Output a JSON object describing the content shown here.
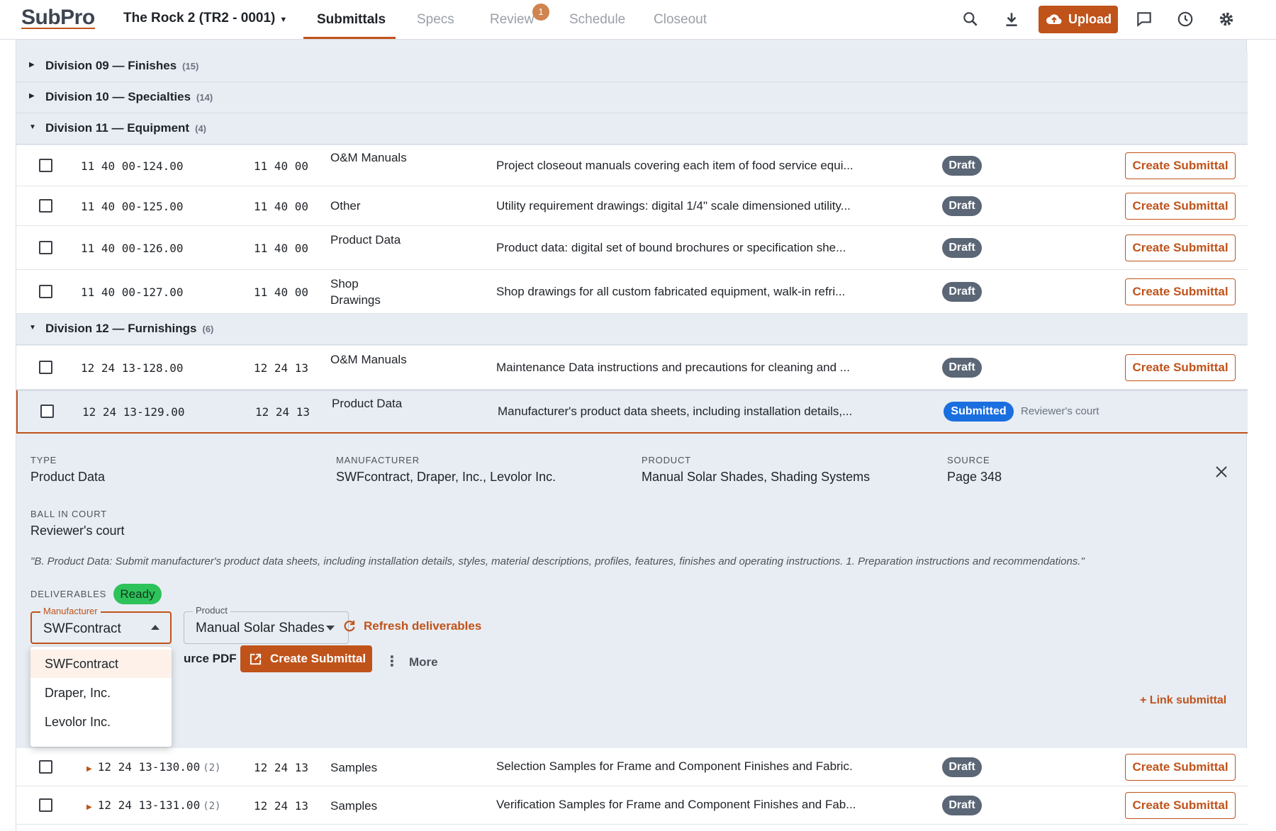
{
  "app": {
    "logo": "SubPro",
    "project": "The Rock 2 (TR2 - 0001)"
  },
  "nav": {
    "tabs": [
      {
        "label": "Submittals"
      },
      {
        "label": "Specs"
      },
      {
        "label": "Review"
      },
      {
        "label": "Schedule"
      },
      {
        "label": "Closeout"
      }
    ],
    "review_badge": "1",
    "upload_label": "Upload"
  },
  "divisions": [
    {
      "title": "Division 09 — Finishes",
      "count": "(15)",
      "expanded": false
    },
    {
      "title": "Division 10 — Specialties",
      "count": "(14)",
      "expanded": false
    },
    {
      "title": "Division 11 — Equipment",
      "count": "(4)",
      "expanded": true
    },
    {
      "title": "Division 12 — Furnishings",
      "count": "(6)",
      "expanded": true
    }
  ],
  "rows_div11": [
    {
      "code": "11 40 00-124.00",
      "spec": "11 40 00",
      "type": "O&M Manuals",
      "desc": "Project closeout manuals covering each item of food service equi...",
      "status": "Draft",
      "action": "Create Submittal"
    },
    {
      "code": "11 40 00-125.00",
      "spec": "11 40 00",
      "type": "Other",
      "desc": "Utility requirement drawings: digital 1/4\" scale dimensioned utility...",
      "status": "Draft",
      "action": "Create Submittal"
    },
    {
      "code": "11 40 00-126.00",
      "spec": "11 40 00",
      "type": "Product Data",
      "desc": "Product data: digital set of bound brochures or specification she...",
      "status": "Draft",
      "action": "Create Submittal"
    },
    {
      "code": "11 40 00-127.00",
      "spec": "11 40 00",
      "type": "Shop Drawings",
      "desc": "Shop drawings for all custom fabricated equipment, walk-in refri...",
      "status": "Draft",
      "action": "Create Submittal"
    }
  ],
  "rows_div12": [
    {
      "code": "12 24 13-128.00",
      "spec": "12 24 13",
      "type": "O&M Manuals",
      "desc": "Maintenance Data instructions and precautions for cleaning and ...",
      "status": "Draft",
      "action": "Create Submittal"
    },
    {
      "code": "12 24 13-129.00",
      "spec": "12 24 13",
      "type": "Product Data",
      "desc": "Manufacturer's product data sheets, including installation details,...",
      "status": "Submitted",
      "court": "Reviewer's court"
    },
    {
      "code": "12 24 13-130.00",
      "sub": "(2)",
      "spec": "12 24 13",
      "type": "Samples",
      "desc": "Selection Samples for Frame and Component Finishes and Fabric.",
      "status": "Draft",
      "action": "Create Submittal"
    },
    {
      "code": "12 24 13-131.00",
      "sub": "(2)",
      "spec": "12 24 13",
      "type": "Samples",
      "desc": "Verification Samples for Frame and Component Finishes and Fab...",
      "status": "Draft",
      "action": "Create Submittal"
    }
  ],
  "detail": {
    "type_label": "TYPE",
    "type_value": "Product Data",
    "manufacturer_label": "MANUFACTURER",
    "manufacturer_value": "SWFcontract, Draper, Inc., Levolor Inc.",
    "product_label": "PRODUCT",
    "product_value": "Manual Solar Shades, Shading Systems",
    "source_label": "SOURCE",
    "source_value": "Page 348",
    "court_label": "BALL IN COURT",
    "court_value": "Reviewer's court",
    "quote": "\"B. Product Data: Submit manufacturer's product data sheets, including installation details, styles, material descriptions, profiles, features, finishes and operating instructions. 1. Preparation instructions and recommendations.\"",
    "deliverables_label": "DELIVERABLES",
    "deliverables_status": "Ready",
    "manufacturer_field": {
      "label": "Manufacturer",
      "value": "SWFcontract"
    },
    "product_field": {
      "label": "Product",
      "value": "Manual Solar Shades"
    },
    "refresh_label": "Refresh deliverables",
    "source_pdf_label": "urce PDF",
    "create_label": "Create Submittal",
    "more_label": "More",
    "link_label": "+ Link submittal",
    "menu_options": [
      "SWFcontract",
      "Draper, Inc.",
      "Levolor Inc."
    ]
  },
  "colors": {
    "accent": "#c0531a",
    "draft": "#5b6676",
    "submitted": "#1a6fe0",
    "ready": "#2ec25a"
  }
}
